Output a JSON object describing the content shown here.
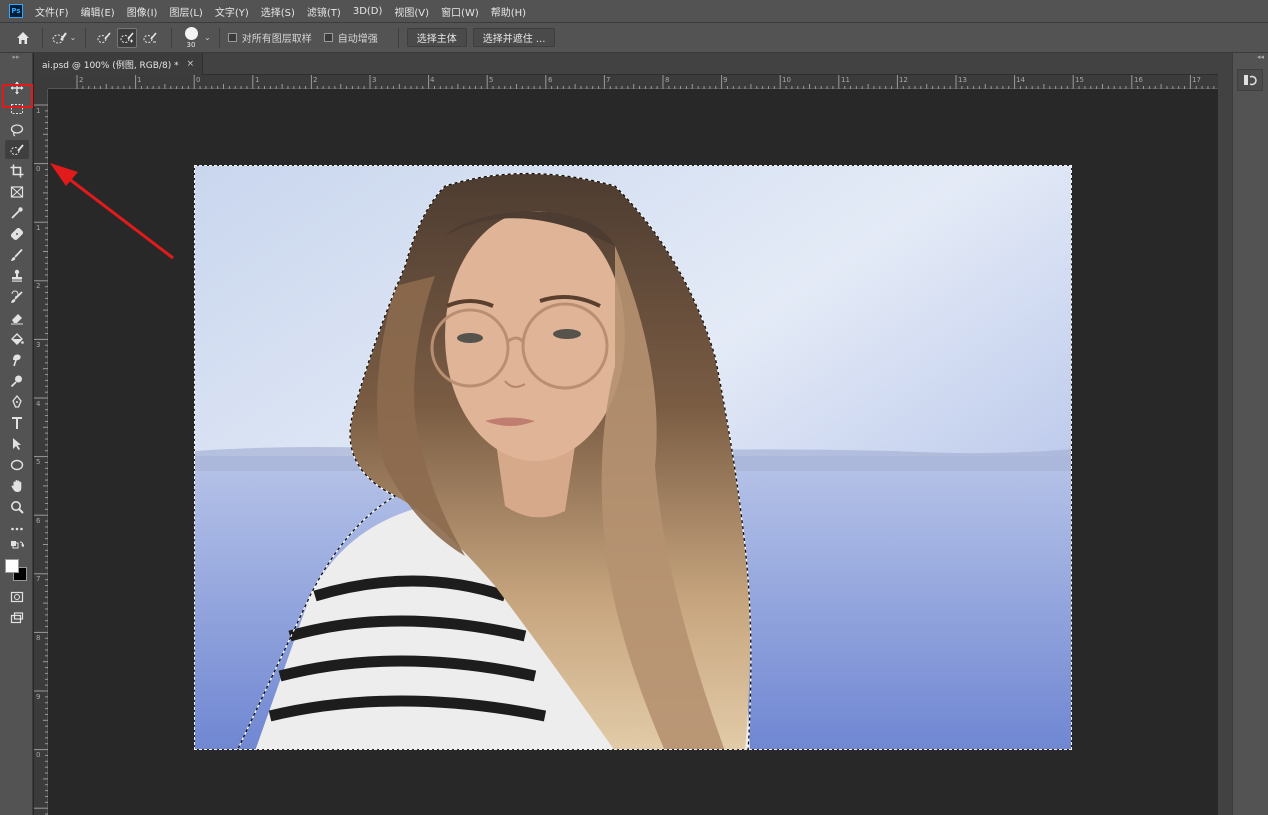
{
  "app": {
    "logo": "Ps"
  },
  "menu": [
    "文件(F)",
    "编辑(E)",
    "图像(I)",
    "图层(L)",
    "文字(Y)",
    "选择(S)",
    "滤镜(T)",
    "3D(D)",
    "视图(V)",
    "窗口(W)",
    "帮助(H)"
  ],
  "options": {
    "brush_size": "30",
    "sample_all_layers": "对所有图层取样",
    "auto_enhance": "自动增强",
    "select_subject": "选择主体",
    "select_and_mask": "选择并遮住 ..."
  },
  "document": {
    "tab_title": "ai.psd @ 100% (例图, RGB/8) *",
    "close_symbol": "×"
  },
  "rulers": {
    "top": [
      "2",
      "1",
      "0",
      "1",
      "2",
      "3",
      "4",
      "5",
      "6",
      "7",
      "8",
      "9",
      "10",
      "11",
      "12",
      "13",
      "14",
      "15",
      "16",
      "17"
    ],
    "left": [
      "1",
      "0",
      "1",
      "2",
      "3",
      "4",
      "5",
      "6",
      "7",
      "8",
      "9",
      "0"
    ]
  },
  "toolbar": {
    "active_tool": "quick-selection-tool",
    "foreground_color": "#ffffff",
    "background_color": "#000000"
  },
  "annotation": {
    "color": "#e11b1b",
    "highlights": "quick-selection-tool"
  }
}
